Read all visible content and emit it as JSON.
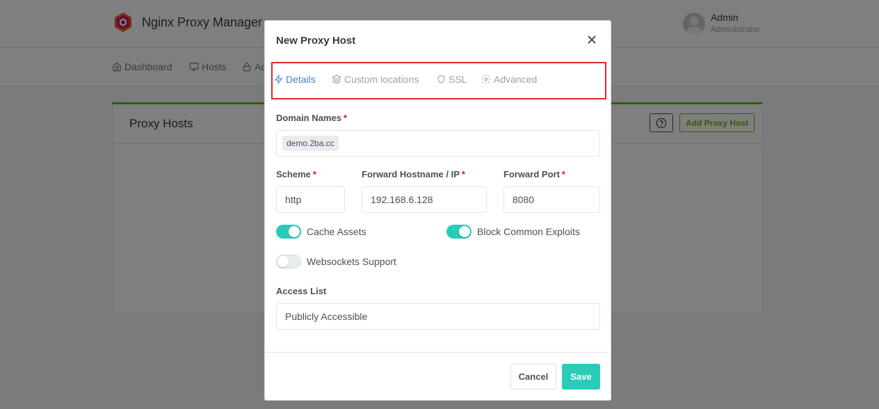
{
  "app": {
    "brand_name": "Nginx Proxy Manager",
    "user_name": "Admin",
    "user_role": "Administrator"
  },
  "nav": {
    "items": [
      {
        "label": "Dashboard",
        "icon": "home-icon"
      },
      {
        "label": "Hosts",
        "icon": "monitor-icon"
      },
      {
        "label": "Ac",
        "icon": "lock-icon"
      }
    ]
  },
  "card": {
    "title": "Proxy Hosts",
    "help_icon": "help-circle-icon",
    "add_button_label": "Add Proxy Host"
  },
  "modal": {
    "title": "New Proxy Host",
    "close_icon": "close-icon",
    "tabs": [
      {
        "label": "Details",
        "icon": "zap-icon",
        "active": true
      },
      {
        "label": "Custom locations",
        "icon": "layers-icon",
        "active": false
      },
      {
        "label": "SSL",
        "icon": "shield-icon",
        "active": false
      },
      {
        "label": "Advanced",
        "icon": "gear-icon",
        "active": false
      }
    ],
    "domain_names_label": "Domain Names",
    "domain_names": [
      "demo.2ba.cc"
    ],
    "scheme_label": "Scheme",
    "scheme_value": "http",
    "forward_host_label": "Forward Hostname / IP",
    "forward_host_value": "192.168.6.128",
    "forward_port_label": "Forward Port",
    "forward_port_value": "8080",
    "required_mark": "*",
    "toggles": {
      "cache_assets": {
        "label": "Cache Assets",
        "on": true
      },
      "block_exploits": {
        "label": "Block Common Exploits",
        "on": true
      },
      "websockets": {
        "label": "Websockets Support",
        "on": false
      }
    },
    "access_list_label": "Access List",
    "access_list_value": "Publicly Accessible",
    "cancel_label": "Cancel",
    "save_label": "Save"
  },
  "colors": {
    "accent_teal": "#2bcbba",
    "active_tab": "#467fcf",
    "highlight_box": "#e0272c",
    "card_top": "#5eba00",
    "required": "#cd201f"
  }
}
